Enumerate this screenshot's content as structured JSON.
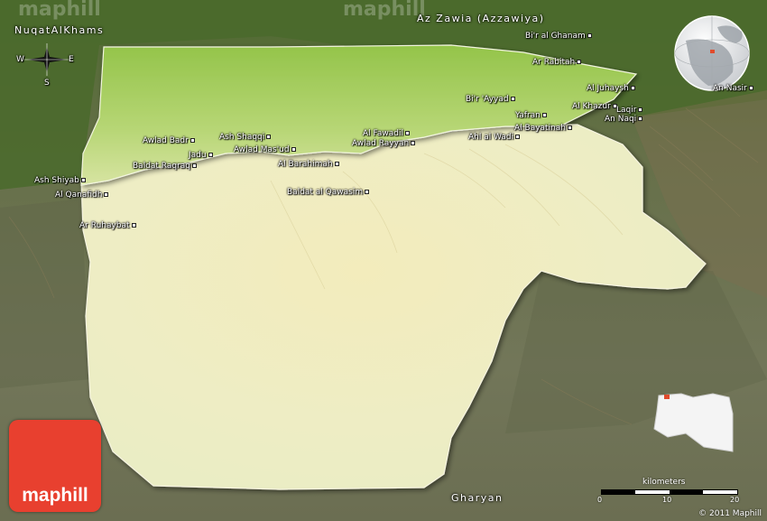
{
  "map": {
    "watermark": "maphill",
    "regions": {
      "northwest": "NuqatAlKhams",
      "north": "Az Zawia (Azzawiya)",
      "south": "Gharyan"
    },
    "places": {
      "bir_al_ghanam": "Bi'r al Ghanam",
      "ar_rabitah": "Ar Rabitah",
      "al_juhaysh": "Al Juhaysh",
      "an_nasir": "An Nasir",
      "bir_ayyad": "Bi'r 'Ayyad",
      "al_khazur": "Al Khazur",
      "laqir": "Laqir",
      "an_naqi": "An Naqi",
      "yafran": "Yafran",
      "al_bayatinah": "Al Bayatinah",
      "ahl_al_wadi": "Ahl al Wadi",
      "al_fawadil": "Al Fawadil",
      "awlad_rayyan": "Awlad Rayyan",
      "awlad_badr": "Awlad Badr",
      "ash_shaqqi": "Ash Shaqqi",
      "awlad_masud": "Awlad Mas'ud",
      "jadu": "Jadu",
      "baldat_raqraq": "Baldat Raqraq",
      "al_barahimah": "Al Barahimah",
      "baldat_al_qawasim": "Baldat al Qawasim",
      "ash_shiyab": "Ash Shiyab",
      "al_qanafidh": "Al Qanafidh",
      "ar_ruhaybat": "Ar Ruhaybat"
    },
    "compass": {
      "west": "W",
      "east": "E",
      "south": "S"
    },
    "scale": {
      "title": "kilometers",
      "ticks": [
        "0",
        "10",
        "20"
      ]
    },
    "logo_text": "maphill",
    "copyright": "© 2011 Maphill",
    "colors": {
      "region_lowland": "#a9cd5e",
      "region_upland": "#f0edc2",
      "outside_terrain": "#707556",
      "outside_north": "#4b6a2c",
      "logo_red": "#e8402f",
      "locator_marker": "#e14b2c"
    }
  }
}
